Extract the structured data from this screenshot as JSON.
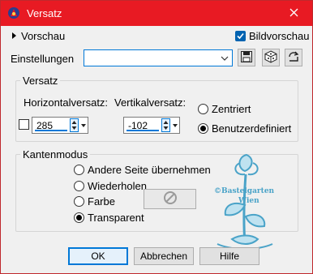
{
  "window": {
    "title": "Versatz"
  },
  "preview": {
    "toggle_label": "Vorschau",
    "bild_label": "Bildvorschau",
    "bild_checked": true
  },
  "settings": {
    "label": "Einstellungen",
    "value": ""
  },
  "offset_group": {
    "title": "Versatz",
    "horizontal_label": "Horizontalversatz:",
    "vertical_label": "Vertikalversatz:",
    "horizontal_value": "285",
    "vertical_value": "-102",
    "link_checked": false,
    "radio_centered": "Zentriert",
    "radio_custom": "Benutzerdefiniert",
    "selected": "custom"
  },
  "edge_group": {
    "title": "Kantenmodus",
    "options": [
      "Andere Seite übernehmen",
      "Wiederholen",
      "Farbe",
      "Transparent"
    ],
    "selected": "Transparent"
  },
  "watermark": {
    "line1": "©Bastelgarten",
    "line2": "Wien"
  },
  "buttons": {
    "ok": "OK",
    "cancel": "Abbrechen",
    "help": "Hilfe"
  },
  "colors": {
    "titlebar": "#e81a23",
    "accent": "#0078d7",
    "dialog_bg": "#f0f0f0",
    "watermark": "#4aa3c8"
  }
}
